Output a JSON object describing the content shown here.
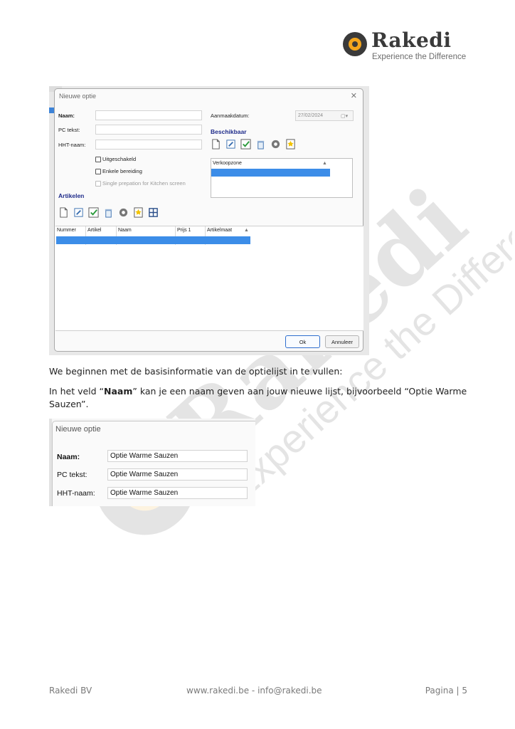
{
  "brand": {
    "name": "Rakedi",
    "tagline": "Experience the Difference"
  },
  "watermark": {
    "name": "Rakedi",
    "tagline": "Experience the Difference"
  },
  "screenshot1": {
    "title": "Nieuwe optie",
    "labels": {
      "naam": "Naam:",
      "pc_tekst": "PC tekst:",
      "hht_naam": "HHT-naam:",
      "aanmaakdatum": "Aanmaakdatum:"
    },
    "date_value": "27/02/2024",
    "section_beschikbaar": "Beschikbaar",
    "section_artikelen": "Artikelen",
    "checkboxes": [
      {
        "label": "Uitgeschakeld",
        "disabled": false
      },
      {
        "label": "Enkele bereiding",
        "disabled": false
      },
      {
        "label": "Single prepation for Kitchen screen",
        "disabled": true
      }
    ],
    "verkoop_header": "Verkoopzone",
    "grid_columns": [
      "Nummer",
      "Artikel",
      "Naam",
      "Prijs 1",
      "Artikelmaat"
    ],
    "buttons": {
      "ok": "Ok",
      "cancel": "Annuleer"
    }
  },
  "paragraphs": {
    "p1": "We beginnen met de basisinformatie van de optielijst in te vullen:",
    "p2_pre": "In het veld “",
    "p2_bold": "Naam",
    "p2_post": "” kan je een naam geven aan jouw nieuwe lijst, bijvoorbeeld “Optie Warme Sauzen”."
  },
  "screenshot2": {
    "title": "Nieuwe optie",
    "rows": [
      {
        "label": "Naam:",
        "value": "Optie Warme Sauzen",
        "bold": true
      },
      {
        "label": "PC tekst:",
        "value": "Optie Warme Sauzen",
        "bold": false
      },
      {
        "label": "HHT-naam:",
        "value": "Optie Warme Sauzen",
        "bold": false
      }
    ]
  },
  "footer": {
    "company": "Rakedi BV",
    "contact": "www.rakedi.be - info@rakedi.be",
    "page": "Pagina | 5"
  },
  "colors": {
    "accent": "#f4a51c",
    "brand_dark": "#3a3a3a",
    "selection": "#3c8de8",
    "section_heading": "#1e2b8a"
  }
}
